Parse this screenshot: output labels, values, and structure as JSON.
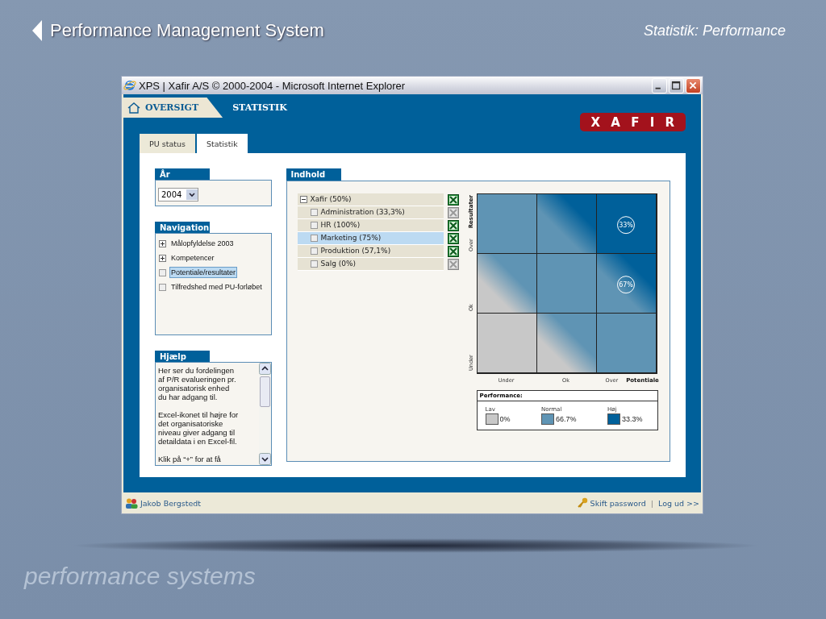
{
  "slide": {
    "title": "Performance Management System",
    "subtitle": "Statistik: Performance",
    "footer": "performance systems"
  },
  "window": {
    "title": "XPS | Xafir A/S © 2000-2004 - Microsoft Internet Explorer"
  },
  "top_nav": [
    {
      "label": "OVERSIGT",
      "kind": "home"
    },
    {
      "label": "STATISTIK",
      "kind": "current"
    }
  ],
  "logo": "X A F I R",
  "tabs": [
    {
      "label": "PU status",
      "selected": false
    },
    {
      "label": "Statistik",
      "selected": true
    }
  ],
  "year_panel": {
    "title": "År",
    "value": "2004"
  },
  "navigation": {
    "title": "Navigation",
    "items": [
      {
        "label": "Målopfyldelse 2003",
        "expandable": true,
        "selected": false
      },
      {
        "label": "Kompetencer",
        "expandable": true,
        "selected": false
      },
      {
        "label": "Potentiale/resultater",
        "expandable": false,
        "selected": true
      },
      {
        "label": "Tilfredshed med PU-forløbet",
        "expandable": false,
        "selected": false
      }
    ]
  },
  "help": {
    "title": "Hjælp",
    "paragraphs": [
      "Her ser du fordelingen\naf P/R evalueringen pr.\norganisatorisk enhed\ndu har adgang til.",
      "Excel-ikonet til højre for\ndet organisatoriske\nniveau giver adgang til\ndetaildata i en Excel-fil.",
      "Klik på “+” for at få"
    ]
  },
  "content": {
    "title": "Indhold",
    "tree": [
      {
        "label": "Xafir (50%)",
        "selected": false,
        "excel": true,
        "children": [
          {
            "label": "Administration (33,3%)",
            "selected": false,
            "excel": false
          },
          {
            "label": "HR (100%)",
            "selected": false,
            "excel": true
          },
          {
            "label": "Marketing (75%)",
            "selected": true,
            "excel": true
          },
          {
            "label": "Produktion (57,1%)",
            "selected": false,
            "excel": true
          },
          {
            "label": "Salg (0%)",
            "selected": false,
            "excel": false
          }
        ]
      }
    ]
  },
  "matrix": {
    "y_title": "Resultater",
    "x_title": "Potentiale",
    "row_labels": [
      "Over",
      "Ok",
      "Under"
    ],
    "column_labels": [
      "Under",
      "Ok",
      "Over"
    ],
    "grid": [
      [
        {
          "kind": "normal"
        },
        {
          "kind": "blend_high"
        },
        {
          "kind": "high",
          "badge": "33%"
        }
      ],
      [
        {
          "kind": "blend_low"
        },
        {
          "kind": "normal"
        },
        {
          "kind": "blend_high",
          "badge": "67%"
        }
      ],
      [
        {
          "kind": "low"
        },
        {
          "kind": "blend_low"
        },
        {
          "kind": "normal"
        }
      ]
    ]
  },
  "legend": {
    "title": "Performance:",
    "items": [
      {
        "label": "Lav",
        "value": "0%",
        "color": "#c8c8c8"
      },
      {
        "label": "Normal",
        "value": "66.7%",
        "color": "#5f94b4"
      },
      {
        "label": "Høj",
        "value": "33.3%",
        "color": "#00609a"
      }
    ]
  },
  "status_bar": {
    "user": "Jakob Bergstedt",
    "links": [
      "Skift password",
      "Log ud >>"
    ],
    "separator": "|"
  }
}
